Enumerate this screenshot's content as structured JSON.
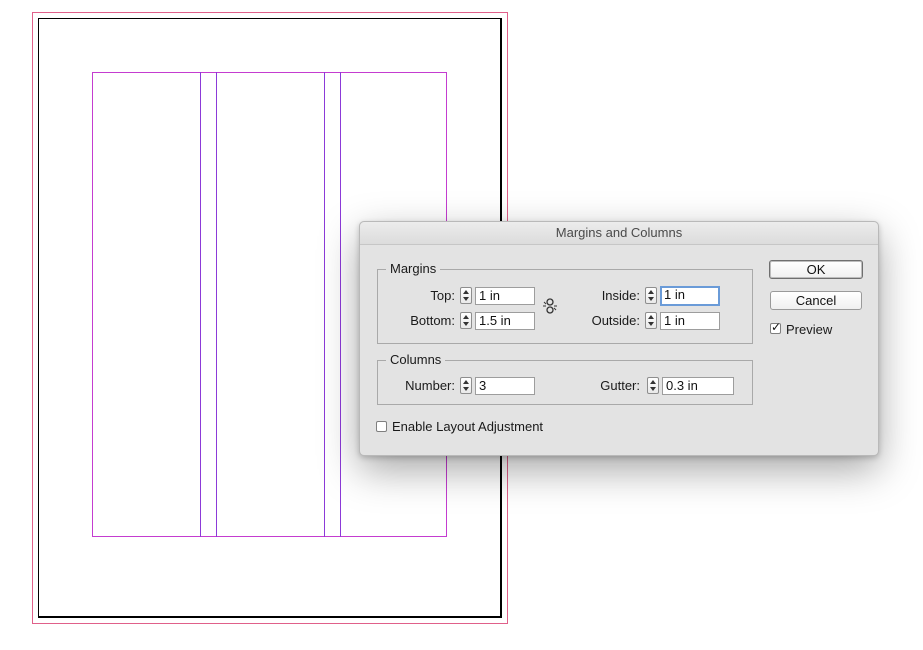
{
  "dialog": {
    "title": "Margins and Columns",
    "margins": {
      "legend": "Margins",
      "top_label": "Top:",
      "top_value": "1 in",
      "bottom_label": "Bottom:",
      "bottom_value": "1.5 in",
      "inside_label": "Inside:",
      "inside_value": "1 in",
      "outside_label": "Outside:",
      "outside_value": "1 in",
      "link_icon": "chain-link-icon"
    },
    "columns": {
      "legend": "Columns",
      "number_label": "Number:",
      "number_value": "3",
      "gutter_label": "Gutter:",
      "gutter_value": "0.3 in"
    },
    "enable_layout_adjustment": {
      "label": "Enable Layout Adjustment",
      "checked": false
    },
    "buttons": {
      "ok": "OK",
      "cancel": "Cancel"
    },
    "preview": {
      "label": "Preview",
      "checked": true
    }
  },
  "colors": {
    "margin_guide": "#c43cd0",
    "column_guide": "#8c3ad8",
    "bleed": "#e0608a",
    "focus_ring": "#6a9bd8"
  }
}
